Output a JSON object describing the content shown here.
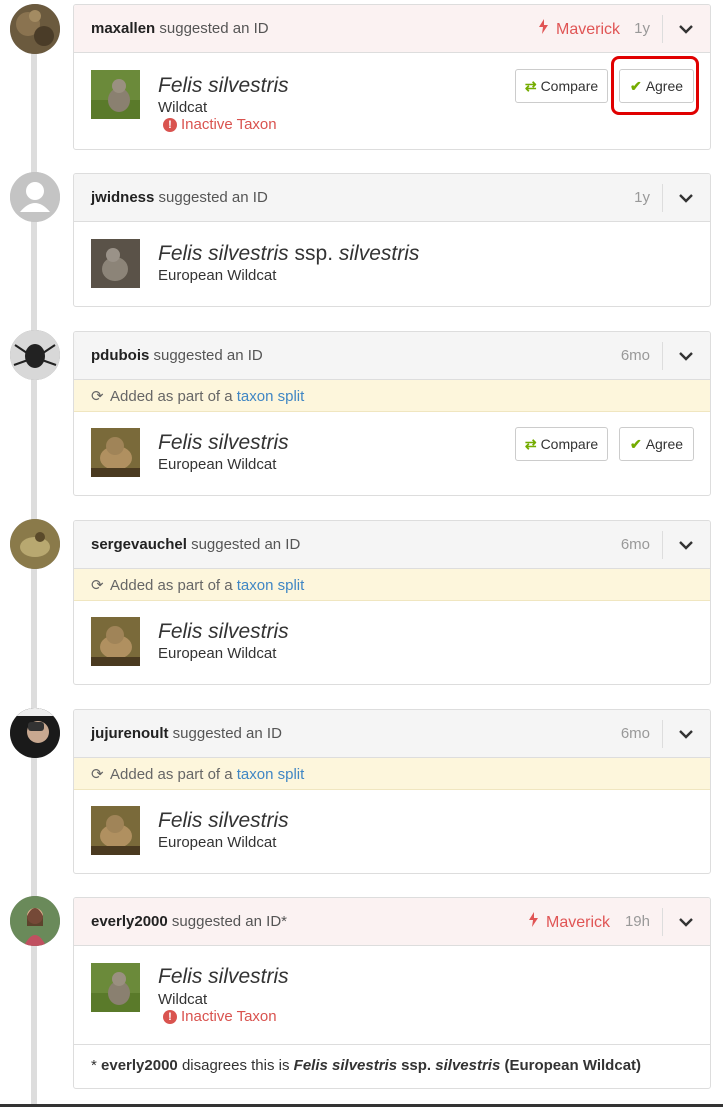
{
  "identifications": [
    {
      "user": "maxallen",
      "action": "suggested an ID",
      "maverick": true,
      "maverick_label": "Maverick",
      "age": "1y",
      "banner": null,
      "taxon": {
        "scientific": "Felis silvestris",
        "rank": "",
        "subspecies": "",
        "common": "Wildcat",
        "inactive": true,
        "inactive_label": "Inactive Taxon"
      },
      "buttons": {
        "compare": "Compare",
        "agree": "Agree"
      },
      "avatar_icon": "user-photo-icon",
      "thumb_icon": "wildcat-photo-icon"
    },
    {
      "user": "jwidness",
      "action": "suggested an ID",
      "maverick": false,
      "age": "1y",
      "banner": null,
      "taxon": {
        "scientific": "Felis silvestris",
        "rank": "ssp.",
        "subspecies": "silvestris",
        "common": "European Wildcat",
        "inactive": false
      },
      "buttons": null,
      "avatar_icon": "default-user-icon",
      "thumb_icon": "wildcat-photo-icon"
    },
    {
      "user": "pdubois",
      "action": "suggested an ID",
      "maverick": false,
      "age": "6mo",
      "banner": {
        "prefix": "Added as part of a",
        "link": "taxon split"
      },
      "taxon": {
        "scientific": "Felis silvestris",
        "rank": "",
        "subspecies": "",
        "common": "European Wildcat",
        "inactive": false
      },
      "buttons": {
        "compare": "Compare",
        "agree": "Agree"
      },
      "avatar_icon": "user-photo-icon",
      "thumb_icon": "wildcat-photo-icon"
    },
    {
      "user": "sergevauchel",
      "action": "suggested an ID",
      "maverick": false,
      "age": "6mo",
      "banner": {
        "prefix": "Added as part of a",
        "link": "taxon split"
      },
      "taxon": {
        "scientific": "Felis silvestris",
        "rank": "",
        "subspecies": "",
        "common": "European Wildcat",
        "inactive": false
      },
      "buttons": null,
      "avatar_icon": "user-photo-icon",
      "thumb_icon": "wildcat-photo-icon"
    },
    {
      "user": "jujurenoult",
      "action": "suggested an ID",
      "maverick": false,
      "age": "6mo",
      "banner": {
        "prefix": "Added as part of a",
        "link": "taxon split"
      },
      "taxon": {
        "scientific": "Felis silvestris",
        "rank": "",
        "subspecies": "",
        "common": "European Wildcat",
        "inactive": false
      },
      "buttons": null,
      "avatar_icon": "user-photo-icon",
      "thumb_icon": "wildcat-photo-icon"
    },
    {
      "user": "everly2000",
      "action": "suggested an ID*",
      "maverick": true,
      "maverick_label": "Maverick",
      "age": "19h",
      "banner": null,
      "taxon": {
        "scientific": "Felis silvestris",
        "rank": "",
        "subspecies": "",
        "common": "Wildcat",
        "inactive": true,
        "inactive_label": "Inactive Taxon"
      },
      "buttons": null,
      "avatar_icon": "user-photo-icon",
      "thumb_icon": "wildcat-photo-icon",
      "footnote": {
        "star": "*",
        "user": "everly2000",
        "text1": "disagrees this is",
        "sci": "Felis silvestris",
        "rank": "ssp.",
        "subspecies": "silvestris",
        "common": "(European Wildcat)"
      }
    }
  ],
  "colors": {
    "maverick": "#e05555",
    "agree_check": "#74ac00",
    "link": "#3f86c4",
    "banner_bg": "#fdf6dc",
    "highlight": "#e00000"
  }
}
